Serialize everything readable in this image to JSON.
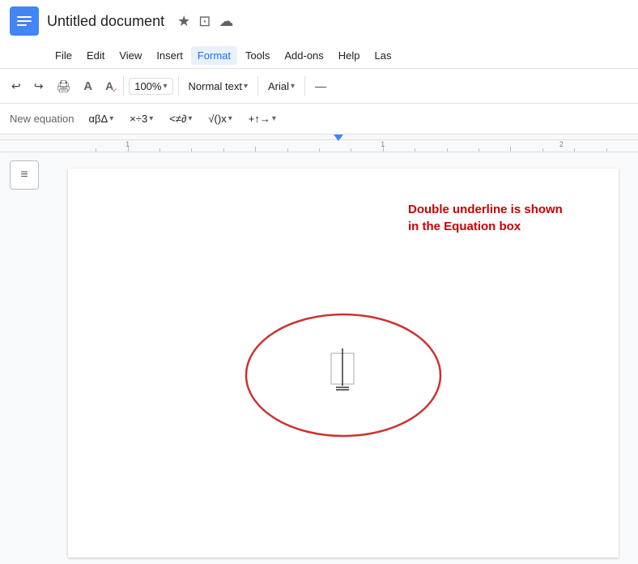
{
  "titleBar": {
    "docTitle": "Untitled document",
    "starIcon": "★",
    "folderIcon": "⊡",
    "cloudIcon": "☁"
  },
  "menuBar": {
    "items": [
      {
        "label": "File",
        "active": false
      },
      {
        "label": "Edit",
        "active": false
      },
      {
        "label": "View",
        "active": false
      },
      {
        "label": "Insert",
        "active": false
      },
      {
        "label": "Format",
        "active": true
      },
      {
        "label": "Tools",
        "active": false
      },
      {
        "label": "Add-ons",
        "active": false
      },
      {
        "label": "Help",
        "active": false
      },
      {
        "label": "Las",
        "active": false
      }
    ]
  },
  "toolbar": {
    "zoom": "100%",
    "style": "Normal text",
    "font": "Arial",
    "undoIcon": "↩",
    "redoIcon": "↪",
    "printIcon": "🖨",
    "paintFormatIcon": "A",
    "chevron": "▾",
    "dashIcon": "—"
  },
  "eqToolbar": {
    "newEquationLabel": "New equation",
    "btn1": "αβΔ ▾",
    "btn2": "×÷3 ▾",
    "btn3": "<≠∂ ▾",
    "btn4": "√()x ▾",
    "btn5": "+↑→ ▾"
  },
  "ruler": {
    "markers": [
      {
        "label": "· · · 1 · · · · · · · 1 · · · · · · · 2 · ·",
        "pos": 0
      }
    ],
    "blueMarkerPos": 420
  },
  "page": {
    "annotationText": "Double underline is shown in the Equation box",
    "ovalColor": "#cc3333"
  },
  "sidebar": {
    "tableIcon": "≡"
  }
}
